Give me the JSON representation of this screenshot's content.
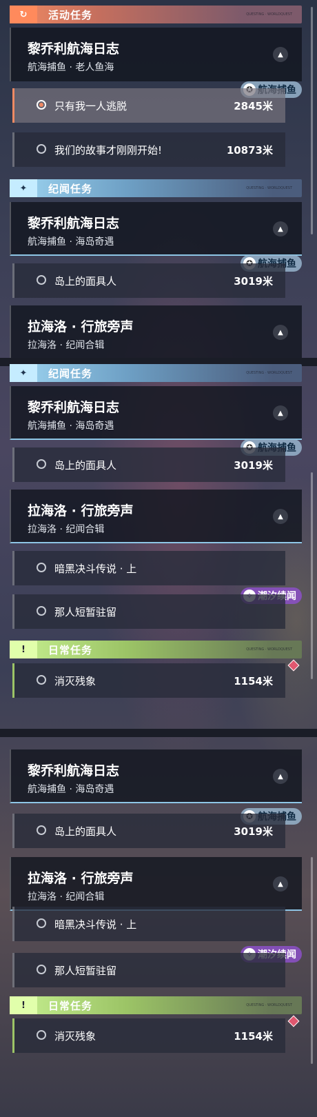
{
  "sections": {
    "active": "活动任务",
    "story": "纪闻任务",
    "daily": "日常任务",
    "tiny": "QUESTING · WORLDQUEST"
  },
  "quests": {
    "lijorli_a": {
      "title": "黎乔利航海日志",
      "subtitle": "航海捕鱼 · 老人鱼海"
    },
    "lijorli_b": {
      "title": "黎乔利航海日志",
      "subtitle": "航海捕鱼 · 海岛奇遇"
    },
    "lahailuo": {
      "title": "拉海洛 · 行旅旁声",
      "subtitle": "拉海洛 · 纪闻合辑"
    }
  },
  "subs": {
    "escape": {
      "label": "只有我一人逃脱",
      "distance": "2845米"
    },
    "story_begin": {
      "label": "我们的故事才刚刚开始!",
      "distance": "10873米"
    },
    "mask": {
      "label": "岛上的面具人",
      "distance": "3019米"
    },
    "duel": {
      "label": "暗黑决斗传说 · 上",
      "distance": ""
    },
    "stay": {
      "label": "那人短暂驻留",
      "distance": ""
    },
    "remnant": {
      "label": "消灭残象",
      "distance": "1154米"
    }
  },
  "tags": {
    "fishing": "航海捕鱼",
    "tide": "潮汐续闻"
  },
  "icons": {
    "active_badge": "↻",
    "story_badge": "✦",
    "daily_badge": "!",
    "toggle": "▲",
    "fish_tag": "✪",
    "tide_tag": "✧"
  },
  "colors": {
    "active": "#f08a63",
    "story": "#9fd6f2",
    "daily": "#c7f091",
    "tide": "#8c50c8",
    "gem": "#e0576f"
  }
}
